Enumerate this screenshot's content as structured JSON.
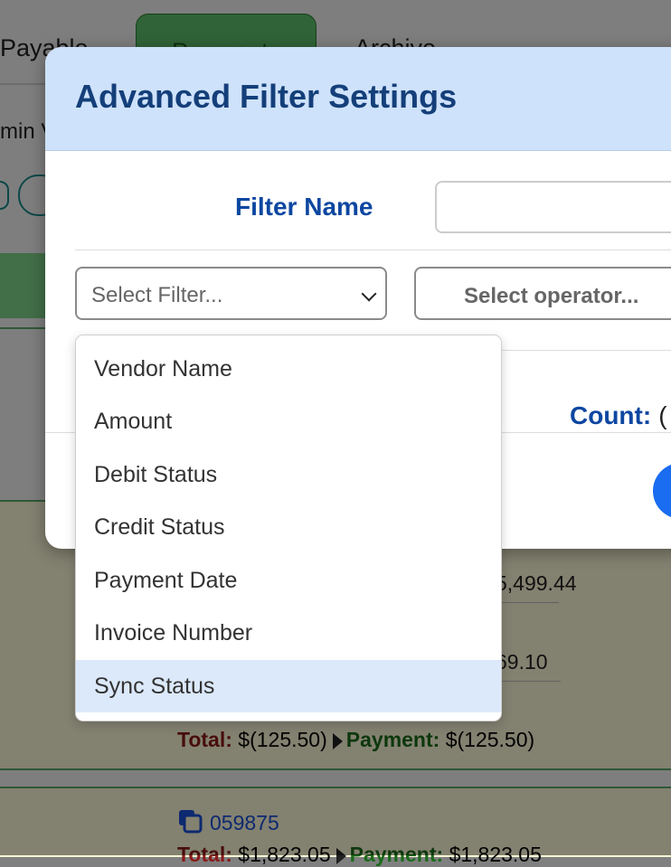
{
  "background": {
    "tabs": [
      "Payable",
      "Payments",
      "Archive"
    ],
    "admin_text": "min V",
    "amounts": [
      "5,499.44",
      "69.10"
    ],
    "total_row": {
      "total_label": "Total:",
      "total_value": "$(125.50)",
      "payment_label": "Payment:",
      "payment_value": "$(125.50)"
    },
    "second_row": {
      "vendor_id": "059875",
      "total_label": "Total:",
      "total_value": "$1,823.05",
      "payment_label": "Payment:",
      "payment_value": "$1,823.05"
    }
  },
  "modal": {
    "title": "Advanced Filter Settings",
    "filter_name_label": "Filter Name",
    "filter_name_value": "",
    "filter_select_placeholder": "Select Filter...",
    "operator_select_placeholder": "Select operator...",
    "count_label": "Count:",
    "count_value": "("
  },
  "dropdown": {
    "options": [
      "Vendor Name",
      "Amount",
      "Debit Status",
      "Credit Status",
      "Payment Date",
      "Invoice Number",
      "Sync Status"
    ],
    "highlighted": "Sync Status"
  },
  "colors": {
    "header_bg": "#cfe2fb",
    "title": "#143f7a",
    "label_blue": "#0d47a1",
    "highlight": "#dce9fb",
    "tab_active": "#5cbf6a",
    "primary_button": "#1a6cf0"
  },
  "icons": {
    "select_arrow": "chevron-down-icon",
    "copy": "copy-icon"
  }
}
